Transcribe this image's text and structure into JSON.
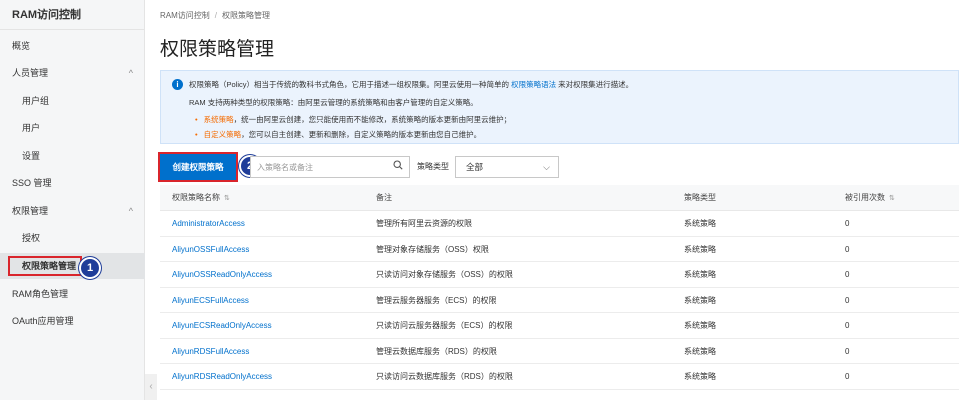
{
  "sidebar": {
    "title": "RAM访问控制",
    "items": [
      {
        "label": "概览",
        "level": 1
      },
      {
        "label": "人员管理",
        "level": 1,
        "chevron": "^"
      },
      {
        "label": "用户组",
        "level": 2
      },
      {
        "label": "用户",
        "level": 2
      },
      {
        "label": "设置",
        "level": 2
      },
      {
        "label": "SSO 管理",
        "level": 1
      },
      {
        "label": "权限管理",
        "level": 1,
        "chevron": "^"
      },
      {
        "label": "授权",
        "level": 2
      },
      {
        "label": "权限策略管理",
        "level": 2,
        "active": true
      },
      {
        "label": "RAM角色管理",
        "level": 1
      },
      {
        "label": "OAuth应用管理",
        "level": 1
      }
    ],
    "collapse_glyph": "‹"
  },
  "badges": {
    "one": "1",
    "two": "2"
  },
  "breadcrumb": {
    "root": "RAM访问控制",
    "separator": "/",
    "current": "权限策略管理"
  },
  "page_title": "权限策略管理",
  "notice": {
    "line1_a": "权限策略（Policy）相当于传统的教科书式角色，它用于描述一组权限集。阿里云使用一种简单的 ",
    "line1_link": "权限策略语法",
    "line1_b": " 来对权限集进行描述。",
    "line2": "RAM 支持两种类型的权限策略：由阿里云管理的系统策略和由客户管理的自定义策略。",
    "line3_term": "系统策略",
    "line3_text": "，统一由阿里云创建，您只能使用而不能修改，系统策略的版本更新由阿里云维护；",
    "line4_term": "自定义策略",
    "line4_text": "，您可以自主创建、更新和删除，自定义策略的版本更新由您自己维护。",
    "bullet": "•",
    "icon": "i"
  },
  "toolbar": {
    "create_label": "创建权限策略",
    "search_placeholder": "入策略名或备注",
    "policy_type_label": "策略类型",
    "policy_type_value": "全部"
  },
  "table": {
    "headers": [
      "权限策略名称",
      "备注",
      "策略类型",
      "被引用次数"
    ],
    "sort_glyph": "⇅",
    "rows": [
      [
        "AdministratorAccess",
        "管理所有阿里云资源的权限",
        "系统策略",
        "0"
      ],
      [
        "AliyunOSSFullAccess",
        "管理对象存储服务（OSS）权限",
        "系统策略",
        "0"
      ],
      [
        "AliyunOSSReadOnlyAccess",
        "只读访问对象存储服务（OSS）的权限",
        "系统策略",
        "0"
      ],
      [
        "AliyunECSFullAccess",
        "管理云服务器服务（ECS）的权限",
        "系统策略",
        "0"
      ],
      [
        "AliyunECSReadOnlyAccess",
        "只读访问云服务器服务（ECS）的权限",
        "系统策略",
        "0"
      ],
      [
        "AliyunRDSFullAccess",
        "管理云数据库服务（RDS）的权限",
        "系统策略",
        "0"
      ],
      [
        "AliyunRDSReadOnlyAccess",
        "只读访问云数据库服务（RDS）的权限",
        "系统策略",
        "0"
      ]
    ]
  },
  "colors": {
    "primary": "#0070cc",
    "highlight": "#d9252c",
    "badge": "#1f3d99",
    "orange": "#f56b00"
  }
}
